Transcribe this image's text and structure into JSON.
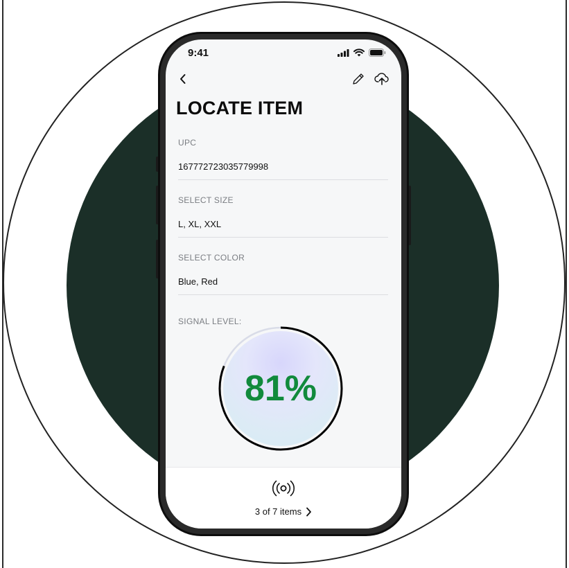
{
  "status_bar": {
    "time": "9:41"
  },
  "header": {
    "title": "LOCATE ITEM"
  },
  "fields": {
    "upc": {
      "label": "UPC",
      "value": "167772723035779998"
    },
    "size": {
      "label": "SELECT SIZE",
      "value": "L, XL, XXL"
    },
    "color": {
      "label": "SELECT COLOR",
      "value": "Blue, Red"
    }
  },
  "signal": {
    "label": "SIGNAL LEVEL:",
    "display": "81%",
    "percent": 81,
    "color": "#118a3c"
  },
  "footer": {
    "items_text": "3 of 7 items"
  },
  "icons": {
    "back": "chevron-left-icon",
    "edit": "pencil-icon",
    "upload": "cloud-upload-icon",
    "scan": "rfid-scan-icon",
    "next": "chevron-right-icon"
  },
  "colors": {
    "brand_dark_green": "#1b2f28",
    "signal_green": "#118a3c"
  }
}
